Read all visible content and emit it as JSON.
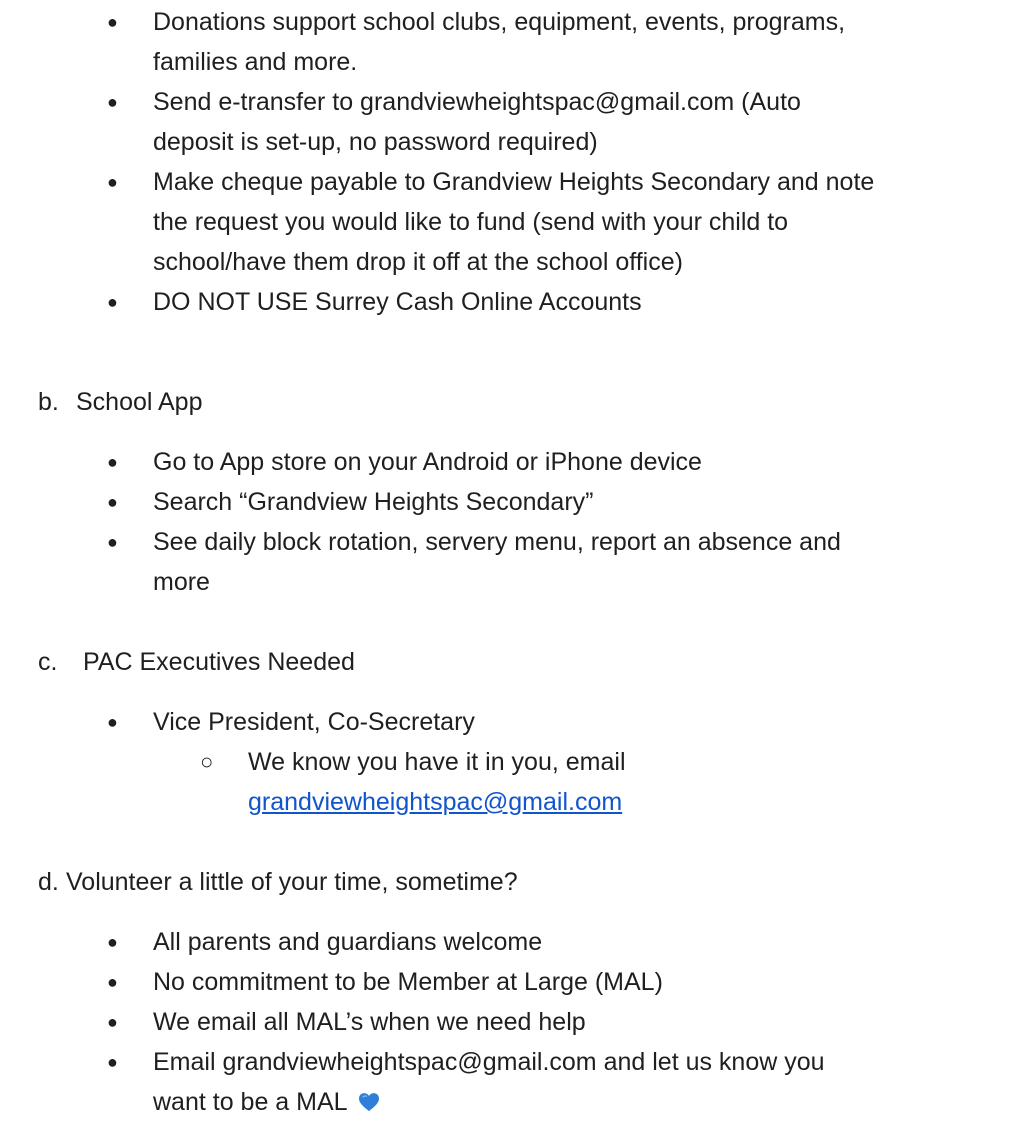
{
  "intro_bullets": [
    {
      "lines": [
        "Donations support school clubs, equipment, events, programs,",
        "families and more."
      ]
    },
    {
      "lines": [
        "Send e-transfer to grandviewheightspac@gmail.com (Auto",
        "deposit is set-up, no password required)"
      ]
    },
    {
      "lines": [
        "Make cheque payable to Grandview Heights Secondary and note",
        "the request you would like to fund (send with your child to",
        "school/have them drop it off at the school office)"
      ]
    },
    {
      "lines": [
        "DO NOT USE Surrey Cash Online Accounts"
      ]
    }
  ],
  "sections": [
    {
      "letter": "b.",
      "title": "School App",
      "bullets": [
        {
          "lines": [
            "Go to App store on your Android or iPhone device"
          ]
        },
        {
          "lines": [
            "Search “Grandview Heights Secondary”"
          ]
        },
        {
          "lines": [
            "See daily block rotation, servery menu, report an absence and",
            "more"
          ]
        }
      ]
    },
    {
      "letter": "c.",
      "title": "PAC Executives Needed",
      "bullets": [
        {
          "lines": [
            "Vice President, Co-Secretary"
          ]
        }
      ],
      "subbullet": {
        "text": "We know you have it in you, email",
        "link": "grandviewheightspac@gmail.com"
      }
    },
    {
      "letter": "d.",
      "title": "Volunteer a little of your time, sometime?",
      "bullets": [
        {
          "lines": [
            "All parents and guardians welcome"
          ]
        },
        {
          "lines": [
            "No commitment to be Member at Large (MAL)"
          ]
        },
        {
          "lines": [
            "We email all MAL’s when we need help"
          ]
        },
        {
          "lines": [
            "Email grandviewheightspac@gmail.com and let us know you",
            "want to be a MAL"
          ]
        }
      ]
    }
  ],
  "glyphs": {
    "bullet": "●",
    "subbullet": "○"
  },
  "colors": {
    "text": "#1f1f1f",
    "link": "#1155cc",
    "heart": "#2f7fd6"
  }
}
